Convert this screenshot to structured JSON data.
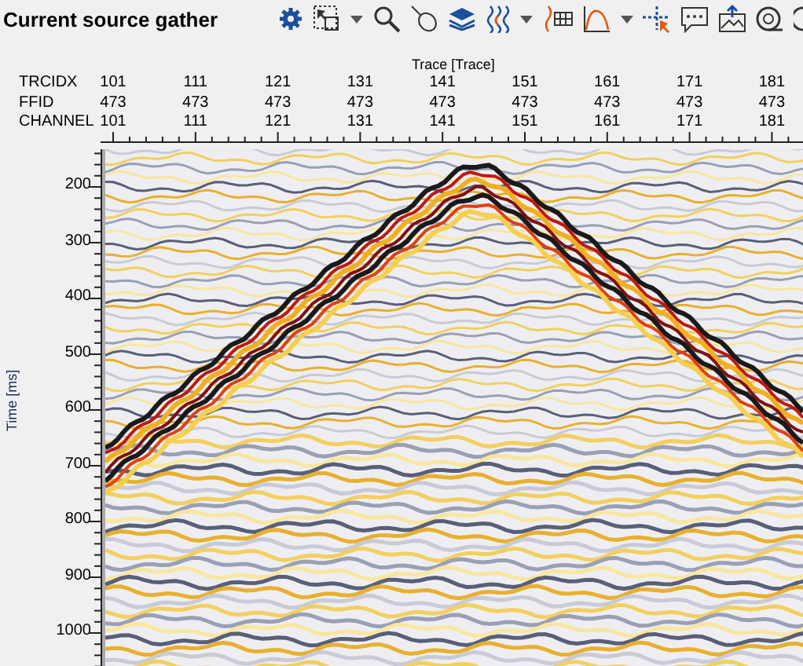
{
  "title": "Current source gather",
  "x_axis": {
    "title": "Trace [Trace]",
    "rows": [
      {
        "label": "TRCIDX",
        "values": [
          "101",
          "111",
          "121",
          "131",
          "141",
          "151",
          "161",
          "171",
          "181"
        ]
      },
      {
        "label": "FFID",
        "values": [
          "473",
          "473",
          "473",
          "473",
          "473",
          "473",
          "473",
          "473",
          "473"
        ]
      },
      {
        "label": "CHANNEL",
        "values": [
          "101",
          "111",
          "121",
          "131",
          "141",
          "151",
          "161",
          "171",
          "181"
        ]
      }
    ]
  },
  "y_axis": {
    "title": "Time [ms]",
    "ticks": [
      "200",
      "300",
      "400",
      "500",
      "600",
      "700",
      "800",
      "900",
      "1000"
    ]
  }
}
